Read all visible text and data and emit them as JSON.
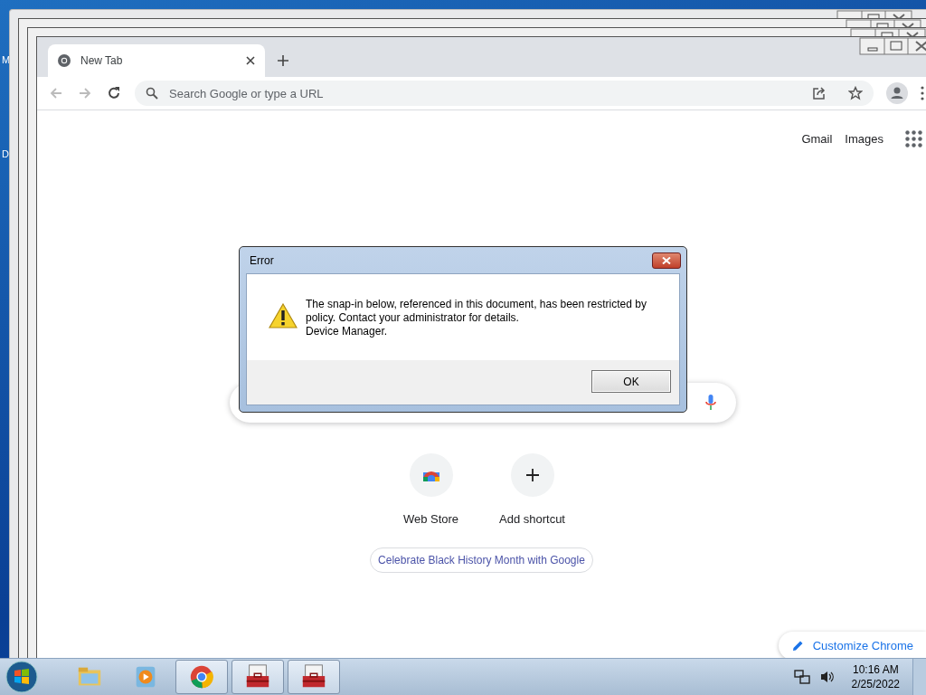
{
  "desktop": {
    "icon_labels": [
      "M",
      "D"
    ]
  },
  "browser": {
    "tab": {
      "title": "New Tab"
    },
    "omnibox": {
      "placeholder": "Search Google or type a URL"
    },
    "header_links": [
      "Gmail",
      "Images"
    ],
    "shortcuts": [
      {
        "label": "Web Store",
        "kind": "webstore"
      },
      {
        "label": "Add shortcut",
        "kind": "add"
      }
    ],
    "promo": "Celebrate Black History Month with Google",
    "customize_button": "Customize Chrome"
  },
  "dialog": {
    "title": "Error",
    "message": "The snap-in below, referenced in this document, has been restricted by policy. Contact your administrator for details.",
    "detail": "Device Manager.",
    "button": "OK"
  },
  "taskbar": {
    "items": [
      {
        "kind": "explorer",
        "running": false
      },
      {
        "kind": "media",
        "running": false
      },
      {
        "kind": "chrome",
        "running": true
      },
      {
        "kind": "toolbox",
        "running": true
      },
      {
        "kind": "toolbox",
        "running": true
      }
    ],
    "clock": {
      "time": "10:16 AM",
      "date": "2/25/2022"
    }
  }
}
